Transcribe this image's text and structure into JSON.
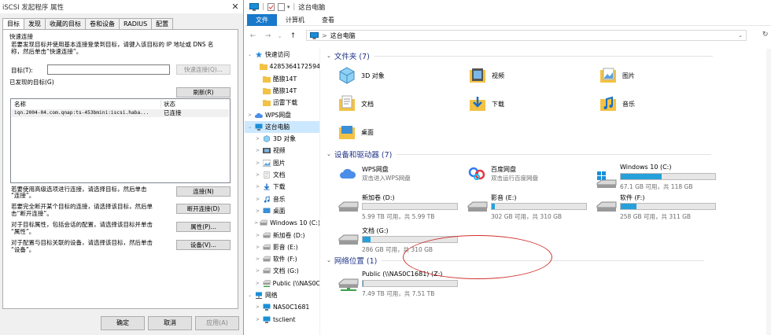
{
  "dialog": {
    "title": "iSCSI 发起程序 属性",
    "close": "✕",
    "tabs": [
      "目标",
      "发现",
      "收藏的目标",
      "卷和设备",
      "RADIUS",
      "配置"
    ],
    "quick_connect": {
      "heading": "快速连接",
      "desc1": "若要发现目标并使用基本连接登录到目标，请键入该目标的 IP 地址或 DNS 名",
      "desc2": "称，然后单击“快速连接”。",
      "target_label": "目标(T):",
      "target_value": "",
      "button": "快速连接(Q)..."
    },
    "discovered": {
      "heading": "已发现的目标(G)",
      "refresh": "刷新(R)",
      "col_name": "名称",
      "col_status": "状态",
      "rows": [
        {
          "name": "iqn.2004-04.com.qnap:ts-453bmini:iscsi.haba...",
          "status": "已连接"
        }
      ]
    },
    "actions": [
      {
        "desc1": "若要使用高级选项进行连接，请选择目标，然后单击",
        "desc2": "“连接”。",
        "button": "连接(N)"
      },
      {
        "desc1": "若要完全断开某个目标的连接，请选择该目标，然后单",
        "desc2": "击“断开连接”。",
        "button": "断开连接(D)"
      },
      {
        "desc1": "对于目标属性，包括会话的配置，请选择该目标并单击",
        "desc2": "“属性”。",
        "button": "属性(P)..."
      },
      {
        "desc1": "对于配置与目标关联的设备，请选择该目标，然后单击",
        "desc2": "“设备”。",
        "button": "设备(V)..."
      }
    ],
    "ok": "确定",
    "cancel": "取消",
    "apply": "应用(A)"
  },
  "explorer": {
    "title": "这台电脑",
    "ribbon_tabs": [
      "文件",
      "计算机",
      "查看"
    ],
    "nav": {
      "back": "←",
      "forward": "→",
      "recent": "⌄",
      "up": "↑"
    },
    "address": "这台电脑",
    "address_arrow": ">",
    "tree": [
      {
        "label": "快速访问",
        "icon": "star-icon",
        "chev": "⌄"
      },
      {
        "label": "4285364172594",
        "icon": "folder-icon",
        "chev": ""
      },
      {
        "label": "酷狼14T",
        "icon": "folder-icon",
        "chev": ""
      },
      {
        "label": "酷狼14T",
        "icon": "folder-icon",
        "chev": ""
      },
      {
        "label": "迅雷下载",
        "icon": "folder-icon",
        "chev": ""
      },
      {
        "label": "WPS网盘",
        "icon": "cloud-icon",
        "chev": ">"
      },
      {
        "label": "这台电脑",
        "icon": "pc-icon",
        "chev": "⌄"
      },
      {
        "label": "3D 对象",
        "icon": "cube-icon",
        "chev": ">"
      },
      {
        "label": "视频",
        "icon": "video-icon",
        "chev": ">"
      },
      {
        "label": "图片",
        "icon": "picture-icon",
        "chev": ">"
      },
      {
        "label": "文档",
        "icon": "document-icon",
        "chev": ">"
      },
      {
        "label": "下载",
        "icon": "download-icon",
        "chev": ">"
      },
      {
        "label": "音乐",
        "icon": "music-icon",
        "chev": ">"
      },
      {
        "label": "桌面",
        "icon": "desktop-icon",
        "chev": ">"
      },
      {
        "label": "Windows 10 (C:)",
        "icon": "drive-icon",
        "chev": ">"
      },
      {
        "label": "新加卷 (D:)",
        "icon": "drive-icon",
        "chev": ">"
      },
      {
        "label": "影音 (E:)",
        "icon": "drive-icon",
        "chev": ">"
      },
      {
        "label": "软件 (F:)",
        "icon": "drive-icon",
        "chev": ">"
      },
      {
        "label": "文档 (G:)",
        "icon": "drive-icon",
        "chev": ">"
      },
      {
        "label": "Public (\\\\NAS0C",
        "icon": "network-drive-icon",
        "chev": ">"
      },
      {
        "label": "网络",
        "icon": "network-icon",
        "chev": "⌄"
      },
      {
        "label": "NAS0C1681",
        "icon": "pc-icon",
        "chev": ">"
      },
      {
        "label": "tsclient",
        "icon": "pc-icon",
        "chev": ">"
      }
    ],
    "folders_header": "文件夹 (7)",
    "folders": [
      "3D 对象",
      "视频",
      "图片",
      "文档",
      "下载",
      "音乐",
      "桌面"
    ],
    "devices_header": "设备和驱动器 (7)",
    "wps": {
      "name": "WPS网盘",
      "sub": "双击进入WPS网盘"
    },
    "baidu": {
      "name": "百度网盘",
      "sub": "双击运行百度网盘"
    },
    "drives": [
      {
        "name": "Windows 10 (C:)",
        "sub": "67.1 GB 可用，共 118 GB",
        "used_fraction": 0.43
      },
      {
        "name": "新加卷 (D:)",
        "sub": "5.99 TB 可用，共 5.99 TB",
        "used_fraction": 0.0
      },
      {
        "name": "影音 (E:)",
        "sub": "302 GB 可用，共 310 GB",
        "used_fraction": 0.03
      },
      {
        "name": "软件 (F:)",
        "sub": "258 GB 可用，共 311 GB",
        "used_fraction": 0.17
      },
      {
        "name": "文档 (G:)",
        "sub": "286 GB 可用，共 310 GB",
        "used_fraction": 0.08
      }
    ],
    "network_header": "网络位置 (1)",
    "network_drive": {
      "name": "Public (\\\\NAS0C1681) (Z:)",
      "sub": "7.49 TB 可用，共 7.51 TB",
      "used_fraction": 0.003
    },
    "colors": {
      "accent": "#1979ca",
      "bar": "#26a0da",
      "annotation": "#d0312d",
      "folder": "#f3c244"
    }
  }
}
